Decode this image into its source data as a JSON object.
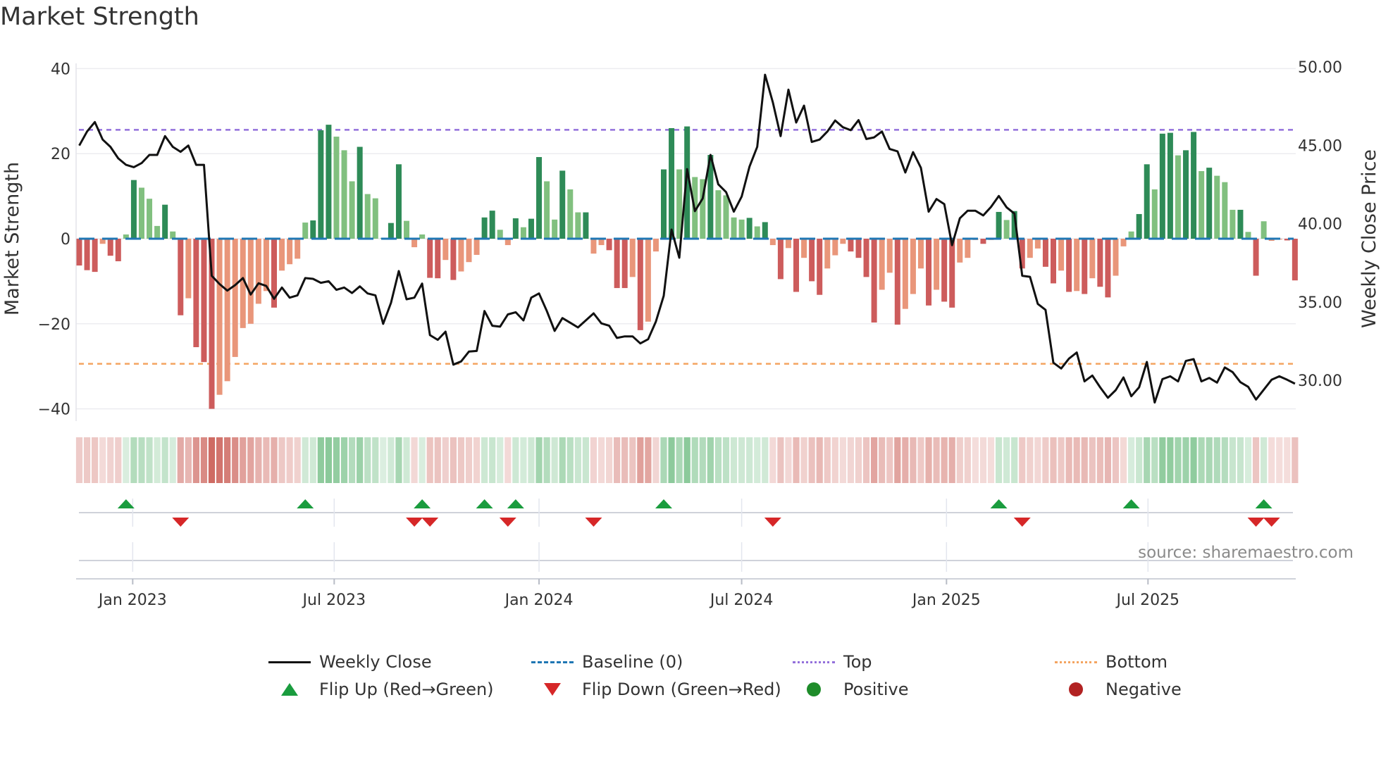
{
  "title": "Market Strength",
  "source_note": "source: sharemaestro.com",
  "colors": {
    "pos_strong": "#2e8b57",
    "pos_weak": "#81c07f",
    "neg_strong": "#cd5c5c",
    "neg_weak": "#e9967a",
    "baseline": "#1f77b4",
    "top": "#9370db",
    "bottom": "#f4a460",
    "flip_up": "#1a9c3e",
    "flip_down": "#d62728",
    "positive": "#1e8c2a",
    "negative": "#b22222",
    "price": "#111111"
  },
  "chart_data": {
    "type": "bar+line",
    "title": "Market Strength",
    "ylabel": "Market Strength",
    "y2label": "Weekly Close Price",
    "ylim": [
      -43,
      43
    ],
    "y2lim": [
      28.4,
      50.1
    ],
    "yticks": [
      {
        "v": 40,
        "label": "40"
      },
      {
        "v": 20,
        "label": "20"
      },
      {
        "v": 0,
        "label": "0"
      },
      {
        "v": -20,
        "label": "−20"
      },
      {
        "v": -40,
        "label": "−40"
      }
    ],
    "y2ticks": [
      {
        "v": 50,
        "label": "50.00"
      },
      {
        "v": 45,
        "label": "45.00"
      },
      {
        "v": 40,
        "label": "40.00"
      },
      {
        "v": 35,
        "label": "35.00"
      },
      {
        "v": 30,
        "label": "30.00"
      }
    ],
    "x_start": "2022-11-14",
    "x_step_days": 7,
    "xticks": [
      {
        "date": "2023-01-01",
        "label": "Jan 2023"
      },
      {
        "date": "2023-07-01",
        "label": "Jul 2023"
      },
      {
        "date": "2024-01-01",
        "label": "Jan 2024"
      },
      {
        "date": "2024-07-01",
        "label": "Jul 2024"
      },
      {
        "date": "2025-01-01",
        "label": "Jan 2025"
      },
      {
        "date": "2025-07-01",
        "label": "Jul 2025"
      }
    ],
    "top_level": 25.6,
    "bottom_level": -29.4,
    "strength": [
      -6.3,
      -7.4,
      -7.8,
      -1.2,
      -4,
      -5.3,
      1,
      13.8,
      12,
      9.4,
      3,
      8,
      1.7,
      -18,
      -14,
      -25.5,
      -29,
      -40,
      -36.7,
      -33.5,
      -27.8,
      -21,
      -20,
      -15.3,
      -12.3,
      -16.2,
      -7.5,
      -6,
      -4.7,
      3.8,
      4.3,
      25.5,
      26.8,
      24,
      20.8,
      13.5,
      21.6,
      10.5,
      9.5,
      0.2,
      3.7,
      17.5,
      4.2,
      -2,
      1,
      -9.2,
      -9.3,
      -5,
      -9.7,
      -7.7,
      -5.5,
      -3.8,
      5,
      6.6,
      2.1,
      -1.5,
      4.8,
      2.7,
      4.7,
      19.2,
      13.5,
      4.5,
      16,
      11.6,
      6.2,
      6.2,
      -3.5,
      -1.5,
      -2.7,
      -11.6,
      -11.6,
      -9,
      -21.5,
      -19.5,
      -3,
      16.3,
      26,
      16.3,
      26.4,
      14.5,
      14,
      19.7,
      11.4,
      10.2,
      5,
      4.5,
      4.9,
      2.9,
      3.9,
      -1.5,
      -9.5,
      -2.2,
      -12.5,
      -4.5,
      -10,
      -13.2,
      -7,
      -3.9,
      -1.2,
      -3,
      -4.5,
      -9,
      -19.7,
      -12,
      -8,
      -20.2,
      -16.5,
      -13,
      -7,
      -15.7,
      -12,
      -14.8,
      -16.2,
      -5.6,
      -4.5,
      -0.3,
      -1.2,
      -0.3,
      6.3,
      4.4,
      6.5,
      -7,
      -4.5,
      -2.3,
      -6.6,
      -10.5,
      -7.5,
      -12.5,
      -12.3,
      -13,
      -9.3,
      -11.3,
      -13.8,
      -8.7,
      -1.8,
      1.7,
      5.8,
      17.5,
      11.6,
      24.7,
      24.9,
      19.6,
      20.8,
      25.1,
      15.9,
      16.7,
      14.8,
      13.3,
      6.8,
      6.8,
      1.6,
      -8.7,
      4.1,
      -0.5,
      -0.2,
      -0.4,
      -9.8
    ],
    "weekly_close": [
      44.98,
      45.88,
      46.48,
      45.36,
      44.9,
      44.16,
      43.75,
      43.6,
      43.86,
      44.38,
      44.38,
      45.58,
      44.9,
      44.58,
      44.98,
      43.75,
      43.75,
      36.67,
      36.14,
      35.72,
      36.07,
      36.52,
      35.47,
      36.19,
      36.02,
      35.2,
      35.92,
      35.27,
      35.42,
      36.52,
      36.47,
      36.22,
      36.32,
      35.77,
      35.92,
      35.57,
      35.99,
      35.54,
      35.42,
      33.6,
      34.94,
      36.97,
      35.17,
      35.27,
      36.17,
      32.88,
      32.58,
      33.1,
      31.0,
      31.2,
      31.83,
      31.87,
      34.42,
      33.48,
      33.42,
      34.2,
      34.34,
      33.82,
      35.27,
      35.54,
      34.42,
      33.15,
      33.97,
      33.67,
      33.37,
      33.82,
      34.27,
      33.63,
      33.48,
      32.7,
      32.8,
      32.8,
      32.35,
      32.62,
      33.75,
      35.39,
      39.62,
      37.82,
      43.48,
      40.79,
      41.6,
      44.38,
      42.51,
      42.01,
      40.76,
      41.72,
      43.63,
      44.9,
      49.5,
      47.75,
      45.58,
      48.55,
      46.45,
      47.53,
      45.21,
      45.36,
      45.88,
      46.58,
      46.15,
      45.96,
      46.6,
      45.4,
      45.5,
      45.88,
      44.76,
      44.61,
      43.26,
      44.56,
      43.56,
      40.76,
      41.57,
      41.24,
      38.62,
      40.34,
      40.82,
      40.82,
      40.52,
      41.06,
      41.76,
      41.04,
      40.64,
      36.67,
      36.6,
      34.87,
      34.49,
      31.12,
      30.75,
      31.38,
      31.77,
      29.93,
      30.3,
      29.55,
      28.88,
      29.37,
      30.18,
      28.98,
      29.55,
      31.17,
      28.58,
      30.07,
      30.25,
      29.93,
      31.23,
      31.35,
      29.93,
      30.15,
      29.85,
      30.82,
      30.52,
      29.88,
      29.58,
      28.77,
      29.4,
      30.03,
      30.25,
      30.03,
      29.78
    ],
    "legend": {
      "placement": "bottom",
      "items": [
        "Weekly Close",
        "Baseline (0)",
        "Top",
        "Bottom",
        "Flip Up (Red→Green)",
        "Flip Down (Green→Red)",
        "Positive",
        "Negative"
      ]
    }
  }
}
